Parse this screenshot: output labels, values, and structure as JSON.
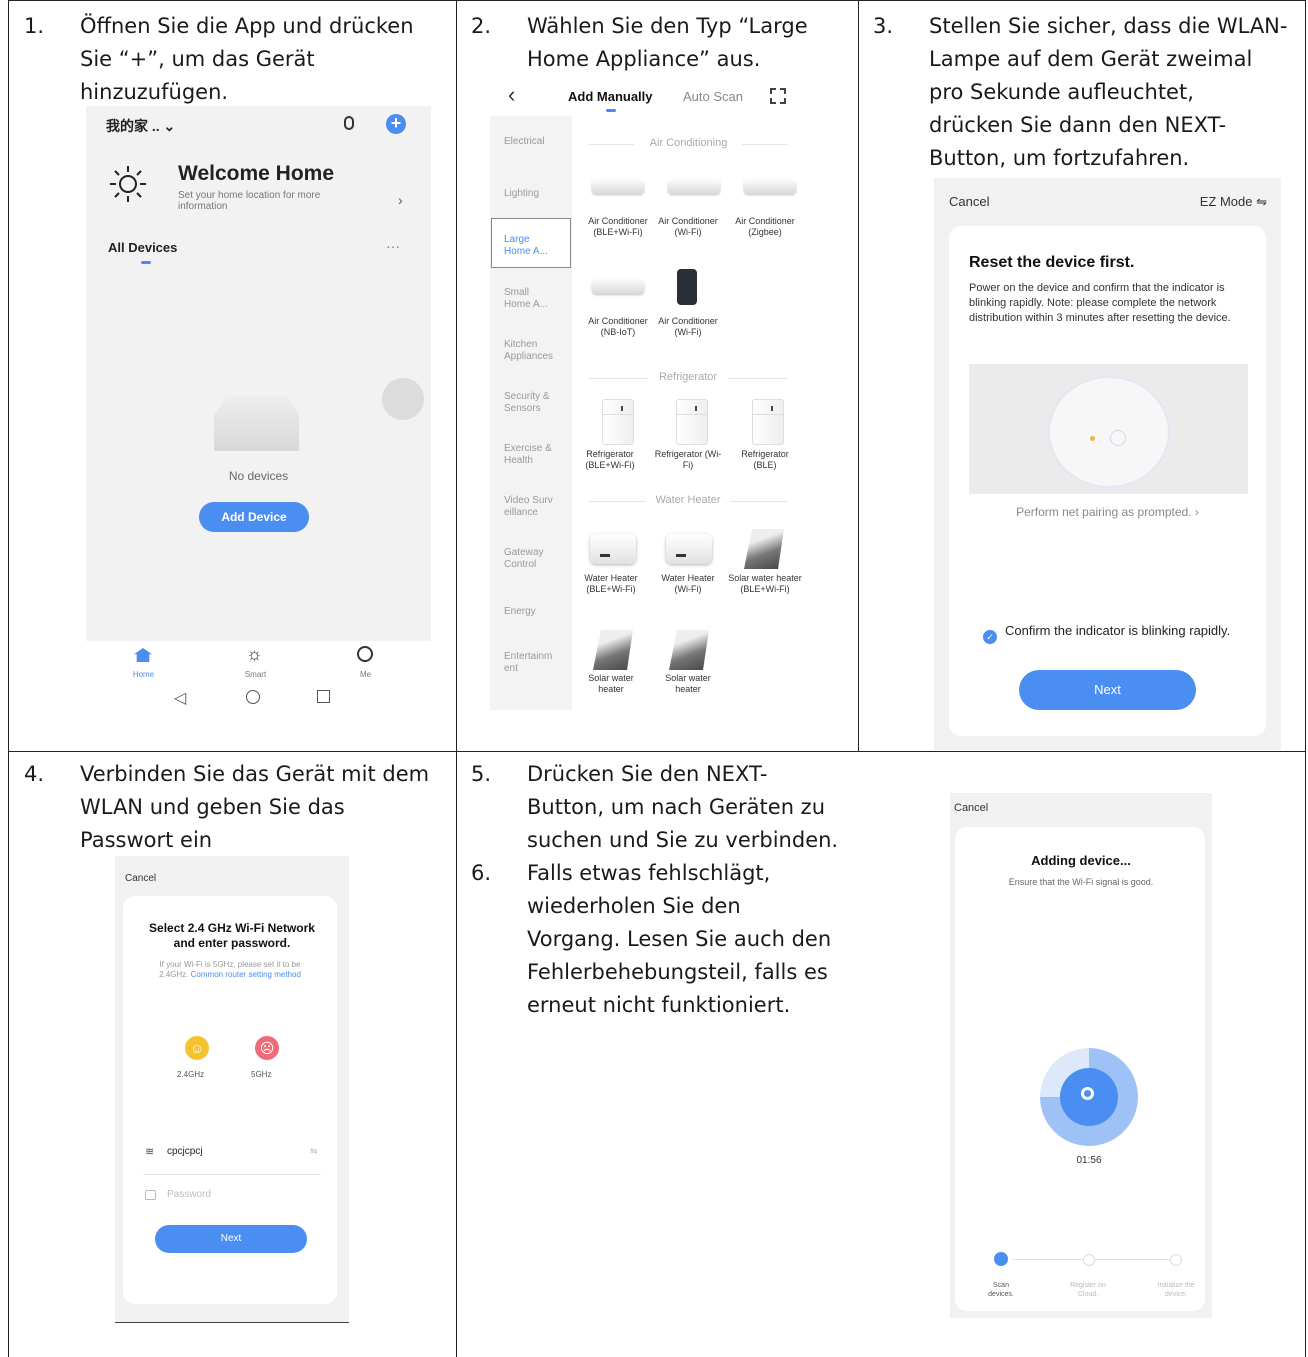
{
  "steps": {
    "s1": {
      "num": "1.",
      "lines": [
        "Öffnen Sie die App und drücken",
        "Sie “+”, um das Gerät",
        "hinzuzufügen."
      ]
    },
    "s2": {
      "num": "2.",
      "lines": [
        "Wählen Sie den Typ “Large",
        "Home Appliance” aus."
      ]
    },
    "s3": {
      "num": "3.",
      "lines": [
        "Stellen Sie sicher, dass die WLAN-",
        "Lampe auf dem Gerät zweimal",
        "pro Sekunde aufleuchtet,",
        "drücken Sie dann den NEXT-",
        "Button, um fortzufahren."
      ]
    },
    "s4": {
      "num": "4.",
      "lines": [
        "Verbinden Sie das Gerät mit dem",
        "WLAN und geben Sie das",
        "Passwort ein"
      ]
    },
    "s5": {
      "num": "5.",
      "lines": [
        "Drücken Sie den NEXT-",
        "Button, um nach Geräten zu",
        "suchen und Sie zu verbinden."
      ]
    },
    "s6": {
      "num": "6.",
      "lines": [
        "Falls etwas fehlschlägt,",
        "wiederholen Sie den",
        "Vorgang. Lesen Sie auch den",
        "Fehlerbehebungsteil, falls es",
        "erneut nicht funktioniert."
      ]
    }
  },
  "screen1": {
    "home_name": "我的家 .. ⌄",
    "welcome_title": "Welcome Home",
    "welcome_sub": "Set your home location for more information",
    "all_devices": "All Devices",
    "more": "···",
    "no_devices": "No devices",
    "add_device": "Add Device",
    "tab_home": "Home",
    "tab_smart": "Smart",
    "tab_me": "Me"
  },
  "screen2": {
    "back": "‹",
    "tab_manual": "Add Manually",
    "tab_auto": "Auto Scan",
    "categories": [
      "Electrical",
      "Lighting",
      "Large Home A...",
      "Small Home A...",
      "Kitchen Appliances",
      "Security & Sensors",
      "Exercise & Health",
      "Video Surv eillance",
      "Gateway Control",
      "Energy",
      "Entertainm ent"
    ],
    "sections": [
      "Air Conditioning",
      "Refrigerator",
      "Water Heater"
    ],
    "devices": [
      "Air Conditioner (BLE+Wi-Fi)",
      "Air Conditioner (Wi-Fi)",
      "Air Conditioner (Zigbee)",
      "Air Conditioner (NB-IoT)",
      "Air Conditioner (Wi-Fi)",
      "Refrigerator (BLE+Wi-Fi)",
      "Refrigerator (Wi-Fi)",
      "Refrigerator (BLE)",
      "Water Heater (BLE+Wi-Fi)",
      "Water Heater (Wi-Fi)",
      "Solar water heater (BLE+Wi-Fi)",
      "Solar water heater",
      "Solar water heater"
    ]
  },
  "screen3": {
    "cancel": "Cancel",
    "mode": "EZ Mode ⇋",
    "title": "Reset the device first.",
    "body": "Power on the device and confirm that the indicator is blinking rapidly. Note: please complete the network distribution within 3 minutes after resetting the device.",
    "hint": "Perform net pairing as prompted. ›",
    "confirm": "Confirm the indicator is blinking rapidly.",
    "next": "Next"
  },
  "screen4": {
    "cancel": "Cancel",
    "title": "Select 2.4 GHz Wi-Fi Network and enter password.",
    "note": "If your Wi-Fi is 5GHz, please set it to be 2.4GHz.",
    "link": "Common router setting method",
    "band1": "2.4GHz",
    "band2": "5GHz",
    "ssid": "cpcjcpcj",
    "password_placeholder": "Password",
    "next": "Next"
  },
  "screen5": {
    "cancel": "Cancel",
    "title": "Adding device...",
    "sub": "Ensure that the Wi-Fi signal is good.",
    "timer": "01:56",
    "stage1": "Scan devices.",
    "stage2": "Register on Cloud.",
    "stage3": "Initialize the device."
  },
  "colors": {
    "accent": "#4b8ef1",
    "grid": "#222222"
  }
}
